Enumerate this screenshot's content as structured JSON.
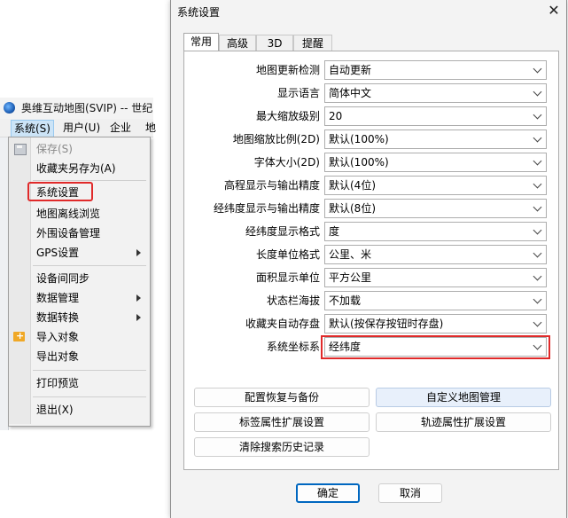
{
  "app": {
    "title": "奥维互动地图(SVIP) -- 世纪",
    "menubar": [
      "系统(S)",
      "用户(U)",
      "企业",
      "地"
    ],
    "menu_items": [
      {
        "label": "保存(S)",
        "disabled": true
      },
      {
        "label": "收藏夹另存为(A)"
      },
      {
        "label": "系统设置"
      },
      {
        "label": "地图离线浏览"
      },
      {
        "label": "外围设备管理"
      },
      {
        "label": "GPS设置",
        "submenu": true
      },
      {
        "label": "设备间同步"
      },
      {
        "label": "数据管理",
        "submenu": true
      },
      {
        "label": "数据转换",
        "submenu": true
      },
      {
        "label": "导入对象"
      },
      {
        "label": "导出对象"
      },
      {
        "label": "打印预览"
      },
      {
        "label": "退出(X)"
      }
    ]
  },
  "dialog": {
    "title": "系统设置",
    "close": "✕",
    "tabs": [
      "常用",
      "高级",
      "3D",
      "提醒"
    ],
    "settings": [
      {
        "label": "地图更新检测",
        "value": "自动更新"
      },
      {
        "label": "显示语言",
        "value": "简体中文"
      },
      {
        "label": "最大缩放级别",
        "value": "20"
      },
      {
        "label": "地图缩放比例(2D)",
        "value": "默认(100%)"
      },
      {
        "label": "字体大小(2D)",
        "value": "默认(100%)"
      },
      {
        "label": "高程显示与输出精度",
        "value": "默认(4位)"
      },
      {
        "label": "经纬度显示与输出精度",
        "value": "默认(8位)"
      },
      {
        "label": "经纬度显示格式",
        "value": "度"
      },
      {
        "label": "长度单位格式",
        "value": "公里、米"
      },
      {
        "label": "面积显示单位",
        "value": "平方公里"
      },
      {
        "label": "状态栏海拔",
        "value": "不加载"
      },
      {
        "label": "收藏夹自动存盘",
        "value": "默认(按保存按钮时存盘)"
      },
      {
        "label": "系统坐标系",
        "value": "经纬度"
      }
    ],
    "buttons": {
      "config_restore": "配置恢复与备份",
      "custom_map": "自定义地图管理",
      "label_ext": "标签属性扩展设置",
      "track_ext": "轨迹属性扩展设置",
      "clear_search": "清除搜索历史记录",
      "ok": "确定",
      "cancel": "取消"
    }
  }
}
